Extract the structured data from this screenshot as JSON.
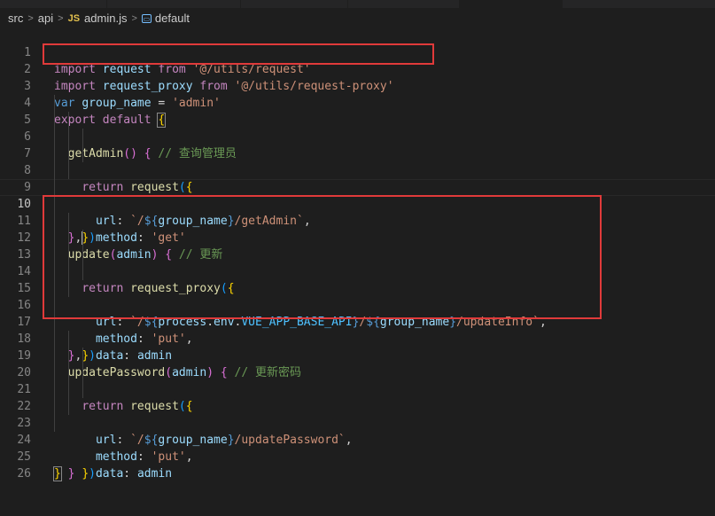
{
  "breadcrumb": {
    "items": [
      "src",
      "api"
    ],
    "file_badge": "JS",
    "file": "admin.js",
    "symbol_icon": "symbol-variable-icon",
    "symbol": "default"
  },
  "editor": {
    "active_line": 10,
    "lines": [
      {
        "n": "1"
      },
      {
        "n": "2"
      },
      {
        "n": "3"
      },
      {
        "n": "4"
      },
      {
        "n": "5"
      },
      {
        "n": "6"
      },
      {
        "n": "7"
      },
      {
        "n": "8"
      },
      {
        "n": "9"
      },
      {
        "n": "10"
      },
      {
        "n": "11"
      },
      {
        "n": "12"
      },
      {
        "n": "13"
      },
      {
        "n": "14"
      },
      {
        "n": "15"
      },
      {
        "n": "16"
      },
      {
        "n": "17"
      },
      {
        "n": "18"
      },
      {
        "n": "19"
      },
      {
        "n": "20"
      },
      {
        "n": "21"
      },
      {
        "n": "22"
      },
      {
        "n": "23"
      },
      {
        "n": "24"
      },
      {
        "n": "25"
      },
      {
        "n": "26"
      }
    ],
    "tokens": {
      "l1": [
        "import",
        "request",
        "from",
        "'@/utils/request'"
      ],
      "l2": [
        "import",
        "request_proxy",
        "from",
        "'@/utils/request-proxy'"
      ],
      "l3": [
        "var",
        "group_name",
        "=",
        "'admin'"
      ],
      "l4": [
        "export",
        "default",
        "{"
      ],
      "l5": [
        "getAdmin",
        "()",
        "{",
        "// 查询管理员"
      ],
      "l6": [
        "return",
        "request",
        "(",
        "{"
      ],
      "l7": [
        "url",
        ":",
        "`/",
        "${",
        "group_name",
        "}",
        "/getAdmin`",
        ","
      ],
      "l8": [
        "method",
        ":",
        "'get'"
      ],
      "l9": [
        "}",
        ")"
      ],
      "l10": [
        "}",
        ","
      ],
      "l11": [
        "update",
        "(",
        "admin",
        ")",
        "{",
        "// 更新"
      ],
      "l12": [
        "return",
        "request_proxy",
        "(",
        "{"
      ],
      "l13": [
        "url",
        ":",
        "`/",
        "${",
        "process",
        ".",
        "env",
        ".",
        "VUE_APP_BASE_API",
        "}",
        "/",
        "${",
        "group_name",
        "}",
        "/updateInfo`",
        ","
      ],
      "l14": [
        "method",
        ":",
        "'put'",
        ","
      ],
      "l15": [
        "data",
        ":",
        "admin"
      ],
      "l16": [
        "}",
        ")"
      ],
      "l17": [
        "}",
        ","
      ],
      "l18": [
        "updatePassword",
        "(",
        "admin",
        ")",
        "{",
        "// 更新密码"
      ],
      "l19": [
        "return",
        "request",
        "(",
        "{"
      ],
      "l20": [
        "url",
        ":",
        "`/",
        "${",
        "group_name",
        "}",
        "/updatePassword`",
        ","
      ],
      "l21": [
        "method",
        ":",
        "'put'",
        ","
      ],
      "l22": [
        "data",
        ":",
        "admin"
      ],
      "l23": [
        "}",
        ")"
      ],
      "l24": [
        "}"
      ],
      "l25": [
        "}"
      ]
    }
  },
  "colors": {
    "background": "#1e1e1e",
    "keyword": "#c586c0",
    "string": "#ce9178",
    "variable": "#9cdcfe",
    "function": "#dcdcaa",
    "comment": "#6a9955",
    "highlight_box": "#e03a3a"
  }
}
